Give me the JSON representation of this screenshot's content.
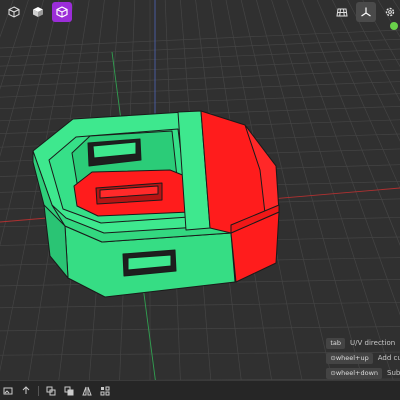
{
  "toolbar_top_left": {
    "items": [
      {
        "icon": "cube-outline-icon",
        "active": false
      },
      {
        "icon": "cube-solid-icon",
        "active": false
      },
      {
        "icon": "cube-shaded-icon",
        "active": true
      }
    ]
  },
  "toolbar_top_right": {
    "items": [
      {
        "icon": "grid-floor-icon",
        "active": false
      },
      {
        "icon": "axes-icon",
        "active": true
      },
      {
        "icon": "gear-icon",
        "active": false
      }
    ]
  },
  "hints": [
    {
      "key": "tab",
      "text": "U/V direction"
    },
    {
      "key": "⊙wheel+up",
      "text": "Add cut"
    },
    {
      "key": "⊙wheel+down",
      "text": "Subtr"
    }
  ],
  "colors": {
    "background": "#303030",
    "grid": "#444444",
    "axis_x": "#b03030",
    "axis_y": "#30a050",
    "axis_z": "#4a5fa8",
    "model_green": "#3ee88e",
    "model_red": "#ff1c1c",
    "accent_purple": "#9b2dd8"
  }
}
